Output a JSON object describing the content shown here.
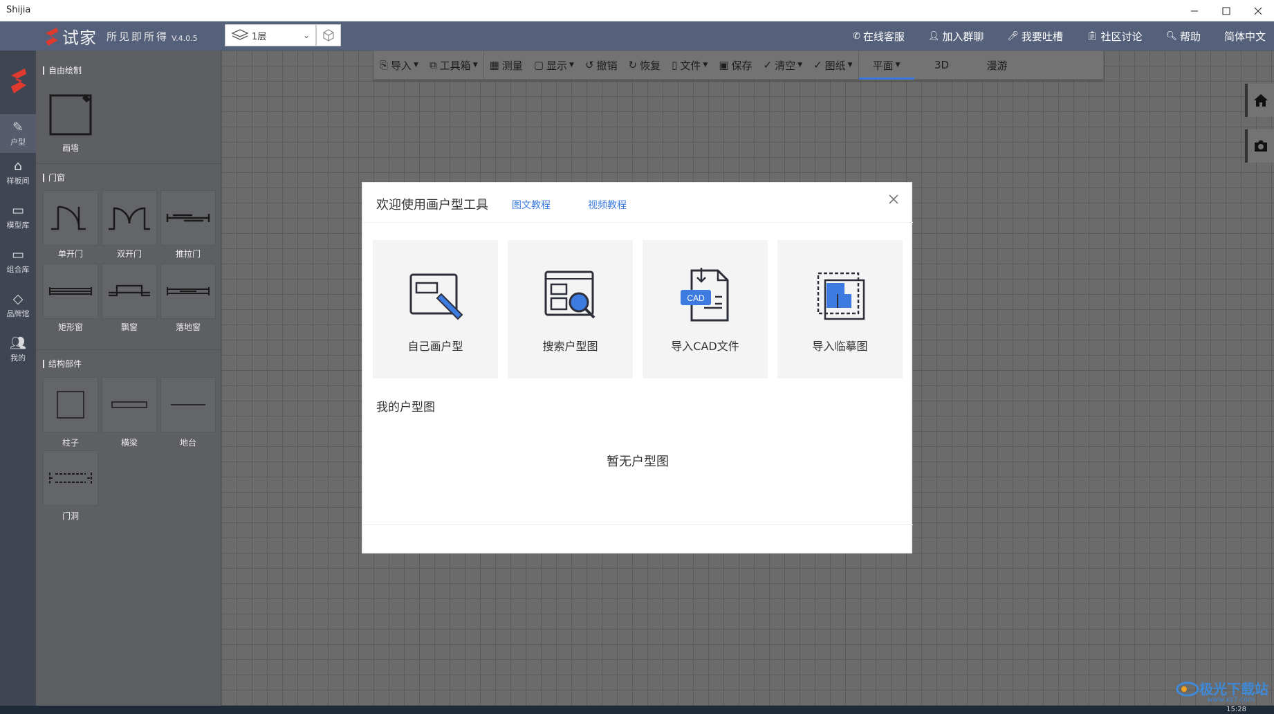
{
  "window": {
    "title": "Shijia"
  },
  "header": {
    "brand": "试家",
    "slogan": "所见即所得",
    "version": "V.4.0.5",
    "floor": "1层",
    "links": [
      {
        "label": "在线客服",
        "icon": "phone-icon"
      },
      {
        "label": "加入群聊",
        "icon": "user-icon"
      },
      {
        "label": "我要吐槽",
        "icon": "mic-icon"
      },
      {
        "label": "社区讨论",
        "icon": "clipboard-icon"
      },
      {
        "label": "帮助",
        "icon": "search-icon"
      },
      {
        "label": "简体中文",
        "icon": ""
      }
    ]
  },
  "leftnav": {
    "items": [
      {
        "label": "户型",
        "icon": "pencil-icon"
      },
      {
        "label": "样板间",
        "icon": "home-icon"
      },
      {
        "label": "模型库",
        "icon": "cube-box-icon"
      },
      {
        "label": "组合库",
        "icon": "combo-box-icon"
      },
      {
        "label": "品牌馆",
        "icon": "brand-badge-icon"
      },
      {
        "label": "我的",
        "icon": "users-icon"
      }
    ]
  },
  "panel": {
    "sections": [
      {
        "title": "自由绘制",
        "items": [
          "画墙"
        ]
      },
      {
        "title": "门窗",
        "items": [
          "单开门",
          "双开门",
          "推拉门",
          "矩形窗",
          "飘窗",
          "落地窗"
        ]
      },
      {
        "title": "结构部件",
        "items": [
          "柱子",
          "横梁",
          "地台",
          "门洞"
        ]
      }
    ]
  },
  "toolbar": {
    "items": [
      {
        "label": "导入",
        "icon": "import-icon",
        "dropdown": true
      },
      {
        "label": "工具箱",
        "icon": "toolbox-icon",
        "dropdown": true
      },
      {
        "label": "测量",
        "icon": "ruler-icon",
        "dropdown": false
      },
      {
        "label": "显示",
        "icon": "display-icon",
        "dropdown": true
      },
      {
        "label": "撤销",
        "icon": "undo-icon",
        "dropdown": false
      },
      {
        "label": "恢复",
        "icon": "redo-icon",
        "dropdown": false
      },
      {
        "label": "文件",
        "icon": "file-icon",
        "dropdown": true
      },
      {
        "label": "保存",
        "icon": "save-icon",
        "dropdown": false
      },
      {
        "label": "清空",
        "icon": "broom-icon",
        "dropdown": true
      },
      {
        "label": "图纸",
        "icon": "drawing-icon",
        "dropdown": true
      }
    ],
    "views": [
      "平面",
      "3D",
      "漫游"
    ],
    "active_view": "平面"
  },
  "modal": {
    "title": "欢迎使用画户型工具",
    "link1": "图文教程",
    "link2": "视频教程",
    "cards": [
      {
        "label": "自己画户型",
        "icon": "draw-floorplan-icon"
      },
      {
        "label": "搜索户型图",
        "icon": "search-floorplan-icon"
      },
      {
        "label": "导入CAD文件",
        "icon": "cad-file-icon"
      },
      {
        "label": "导入临摹图",
        "icon": "trace-image-icon"
      }
    ],
    "cad_badge": "CAD",
    "my_plans_title": "我的户型图",
    "empty_text": "暂无户型图"
  },
  "watermark": {
    "text": "极光下载站",
    "url": "www.xz7.com"
  },
  "taskbar": {
    "clock": "15:28"
  },
  "colors": {
    "accent": "#3d7be0",
    "brand": "#e03a2f",
    "topbar": "#55607a"
  }
}
